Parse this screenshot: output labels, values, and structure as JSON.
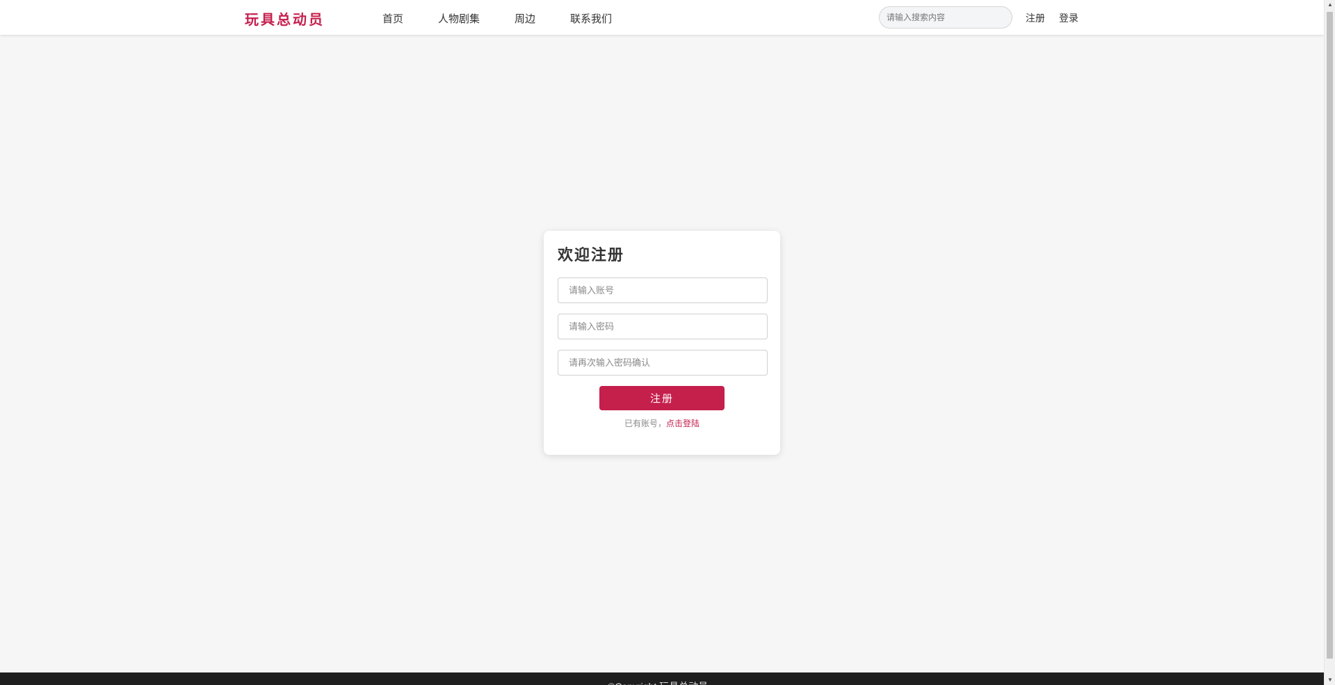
{
  "header": {
    "logo": "玩具总动员",
    "nav": [
      "首页",
      "人物剧集",
      "周边",
      "联系我们"
    ],
    "search_placeholder": "请输入搜索内容",
    "register_label": "注册",
    "login_label": "登录"
  },
  "register_card": {
    "title": "欢迎注册",
    "account_placeholder": "请输入账号",
    "password_placeholder": "请输入密码",
    "confirm_placeholder": "请再次输入密码确认",
    "submit_label": "注册",
    "hint_text": "已有账号，",
    "hint_link": "点击登陆"
  },
  "footer": {
    "copyright": "©Copyright 玩具总动员"
  },
  "colors": {
    "accent": "#c51f4c",
    "page_background": "#f6f6f6",
    "footer_background": "#1f1f1f"
  }
}
